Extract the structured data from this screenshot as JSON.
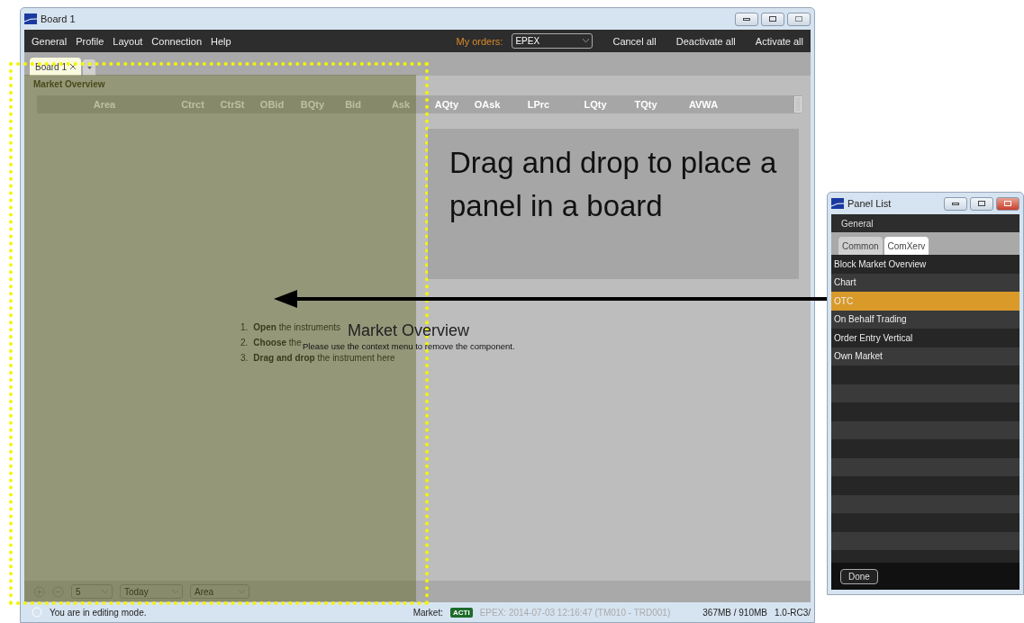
{
  "board_window": {
    "title": "Board 1",
    "menu": [
      "General",
      "Profile",
      "Layout",
      "Connection",
      "Help"
    ],
    "my_orders_label": "My orders:",
    "my_orders_value": "EPEX",
    "actions": [
      "Cancel all",
      "Deactivate all",
      "Activate all"
    ],
    "tabs": [
      {
        "label": "Board 1",
        "selected": true
      }
    ]
  },
  "panel": {
    "title": "Market Overview",
    "columns": [
      "Area",
      "Ctrct",
      "CtrSt",
      "OBid",
      "BQty",
      "Bid",
      "Ask",
      "AQty",
      "OAsk",
      "LPrc",
      "LQty",
      "TQty",
      "AVWA"
    ],
    "instructions": [
      {
        "number": "1.",
        "action": "Open",
        "rest": "the instruments"
      },
      {
        "number": "2.",
        "action": "Choose",
        "rest": "the"
      },
      {
        "number": "3.",
        "action": "Drag and drop",
        "rest": "the instrument here"
      }
    ],
    "selects": [
      "5",
      "Today",
      "Area"
    ]
  },
  "drop_hint": "Drag and drop to place a panel in a board",
  "drag_label": {
    "title": "Market Overview",
    "message": "Please use the context menu to remove the component."
  },
  "status_bar": {
    "message": "You are in editing mode.",
    "market_label": "Market:",
    "market_badge": "ACTI",
    "market_info": "EPEX: 2014-07-03 12:16:47 (TM010 - TRD001)",
    "memory": "367MB / 910MB",
    "version": "1.0-RC3/"
  },
  "panel_list": {
    "title": "Panel List",
    "menu": [
      "General"
    ],
    "tabs": [
      {
        "label": "Common",
        "selected": false
      },
      {
        "label": "ComXerv",
        "selected": true
      }
    ],
    "items": [
      {
        "label": "Block Market Overview",
        "selected": false
      },
      {
        "label": "Chart",
        "selected": false
      },
      {
        "label": "OTC",
        "selected": true
      },
      {
        "label": "On Behalf Trading",
        "selected": false
      },
      {
        "label": "Order Entry Vertical",
        "selected": false
      },
      {
        "label": "Own Market",
        "selected": false
      }
    ],
    "done": "Done"
  }
}
